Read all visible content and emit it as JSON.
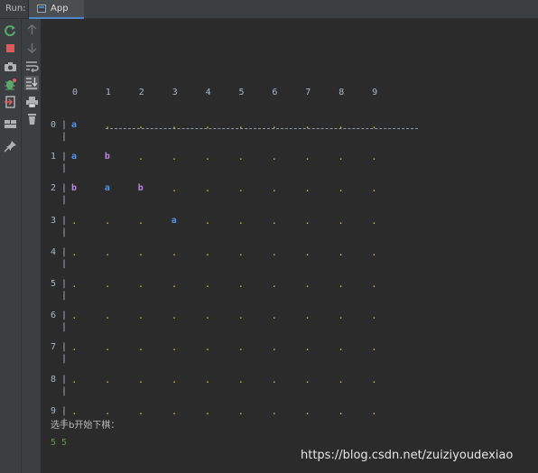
{
  "run_label": "Run:",
  "tab": {
    "label": "App"
  },
  "toolbar_left": [
    "rerun-icon",
    "stop-icon",
    "camera-icon",
    "debug-icon",
    "exit-icon",
    "layout-icon",
    "pin-icon"
  ],
  "toolbar_mid": [
    "up-arrow-icon",
    "down-arrow-icon",
    "soft-wrap-icon",
    "scroll-to-end-icon",
    "print-icon",
    "trash-icon"
  ],
  "board": {
    "columns": [
      "0",
      "1",
      "2",
      "3",
      "4",
      "5",
      "6",
      "7",
      "8",
      "9"
    ],
    "rows": [
      "0",
      "1",
      "2",
      "3",
      "4",
      "5",
      "6",
      "7",
      "8",
      "9"
    ],
    "separator": "----------------------------------------------------",
    "row_bar": "|",
    "empty": ".",
    "cells": [
      [
        "a",
        ".",
        ".",
        ".",
        ".",
        ".",
        ".",
        ".",
        ".",
        "."
      ],
      [
        "a",
        "b",
        ".",
        ".",
        ".",
        ".",
        ".",
        ".",
        ".",
        "."
      ],
      [
        "b",
        "a",
        "b",
        ".",
        ".",
        ".",
        ".",
        ".",
        ".",
        "."
      ],
      [
        ".",
        ".",
        ".",
        "a",
        ".",
        ".",
        ".",
        ".",
        ".",
        "."
      ],
      [
        ".",
        ".",
        ".",
        ".",
        ".",
        ".",
        ".",
        ".",
        ".",
        "."
      ],
      [
        ".",
        ".",
        ".",
        ".",
        ".",
        ".",
        ".",
        ".",
        ".",
        "."
      ],
      [
        ".",
        ".",
        ".",
        ".",
        ".",
        ".",
        ".",
        ".",
        ".",
        "."
      ],
      [
        ".",
        ".",
        ".",
        ".",
        ".",
        ".",
        ".",
        ".",
        ".",
        "."
      ],
      [
        ".",
        ".",
        ".",
        ".",
        ".",
        ".",
        ".",
        ".",
        ".",
        "."
      ],
      [
        ".",
        ".",
        ".",
        ".",
        ".",
        ".",
        ".",
        ".",
        ".",
        "."
      ]
    ]
  },
  "prompt": "选手b开始下棋：",
  "input_echo": "5 5",
  "watermark": "https://blog.csdn.net/zuiziyoudexiao",
  "colors": {
    "piece_a": "#5394ec",
    "piece_b": "#c084e0",
    "empty_dot": "#c9b24a",
    "input": "#5a9a4a"
  }
}
